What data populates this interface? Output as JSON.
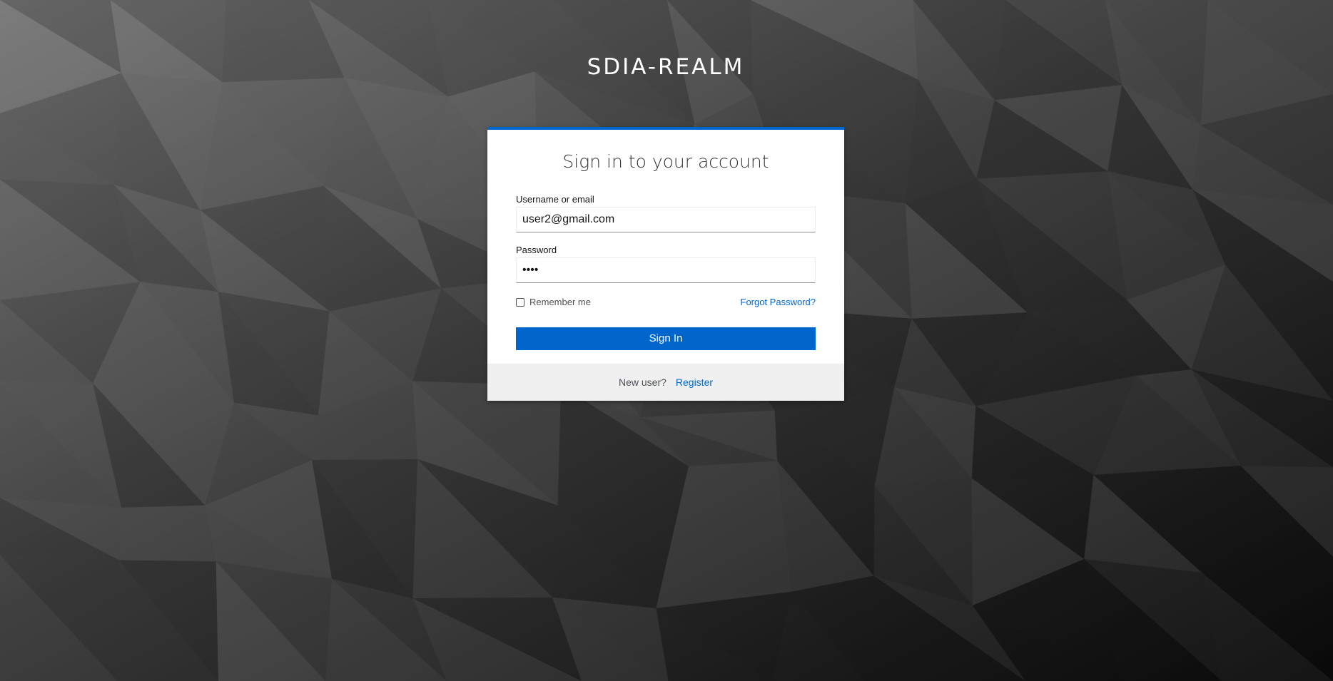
{
  "realm": {
    "title": "SDIA-REALM"
  },
  "login": {
    "heading": "Sign in to your account",
    "username": {
      "label": "Username or email",
      "value": "user2@gmail.com"
    },
    "password": {
      "label": "Password",
      "value": "••••"
    },
    "remember_me": {
      "label": "Remember me",
      "checked": false
    },
    "forgot_password_link": "Forgot Password?",
    "submit_label": "Sign In"
  },
  "footer": {
    "new_user_text": "New user?",
    "register_link": "Register"
  },
  "colors": {
    "accent": "#0066cc",
    "background_dark": "#1c1c1c",
    "background_light": "#8a8a8a"
  }
}
